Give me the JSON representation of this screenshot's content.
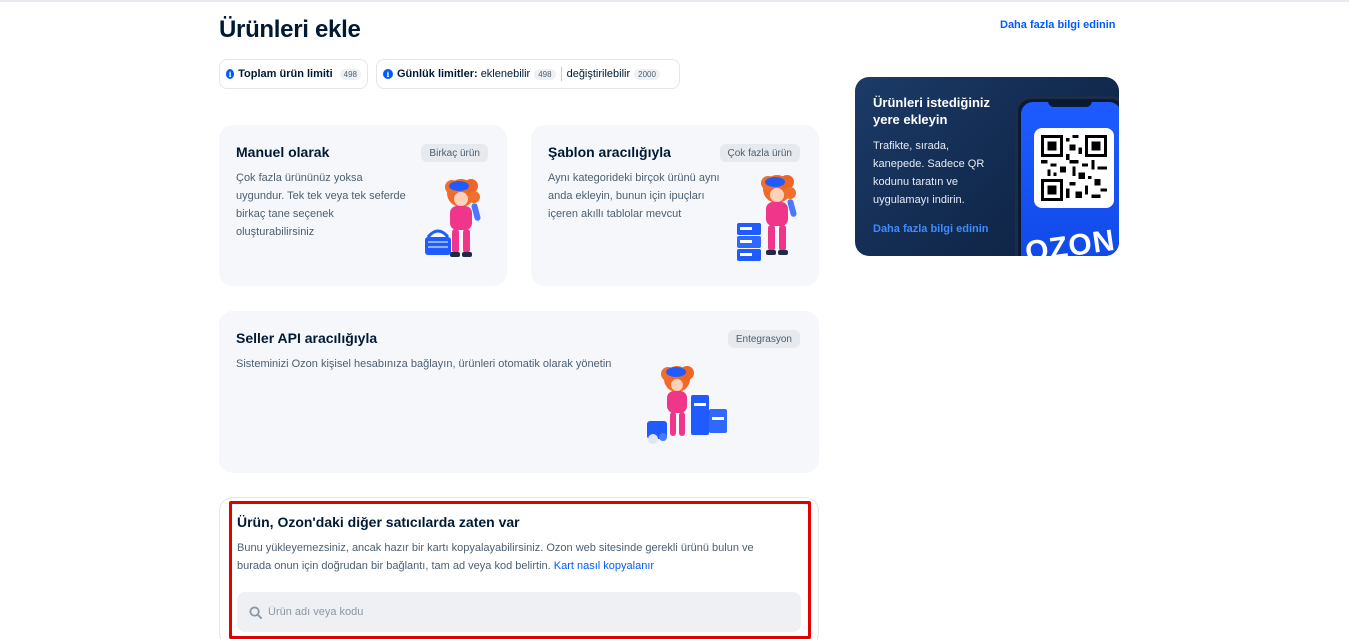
{
  "header": {
    "title": "Ürünleri ekle",
    "more_link": "Daha fazla bilgi edinin"
  },
  "limits": {
    "total_label": "Toplam ürün limiti",
    "total_value": "498",
    "daily_label": "Günlük limitler:",
    "addable_label": "eklenebilir",
    "addable_value": "498",
    "editable_label": "değiştirilebilir",
    "editable_value": "2000"
  },
  "cards": {
    "manual": {
      "title": "Manuel olarak",
      "tag": "Birkaç ürün",
      "desc_lines": [
        "Çok fazla ürününüz yoksa",
        "uygundur. Tek tek veya tek seferde",
        "birkaç tane seçenek",
        "oluşturabilirsiniz"
      ]
    },
    "template": {
      "title": "Şablon aracılığıyla",
      "tag": "Çok fazla ürün",
      "desc_lines": [
        "Aynı kategorideki birçok ürünü aynı",
        "anda ekleyin, bunun için ipuçları",
        "içeren akıllı tablolar mevcut"
      ]
    },
    "api": {
      "title": "Seller API aracılığıyla",
      "tag": "Entegrasyon",
      "desc": "Sisteminizi Ozon kişisel hesabınıza bağlayın, ürünleri otomatik olarak yönetin"
    }
  },
  "promo": {
    "title": "Ürünleri istediğiniz yere ekleyin",
    "desc": "Trafikte, sırada, kanepede. Sadece QR kodunu taratın ve uygulamayı indirin.",
    "link": "Daha fazla bilgi edinin",
    "brand": "OZON"
  },
  "copy_block": {
    "title": "Ürün, Ozon'daki diğer satıcılarda zaten var",
    "desc_line1": "Bunu yükleyemezsiniz, ancak hazır bir kartı kopyalayabilirsiniz. Ozon web sitesinde gerekli ürünü bulun ve",
    "desc_line2": "burada onun için doğrudan bir bağlantı, tam ad veya kod belirtin.",
    "link": "Kart nasıl kopyalanır",
    "search_placeholder": "Ürün adı veya kodu",
    "search_value": ""
  },
  "colors": {
    "accent": "#005bff",
    "highlight_border": "#e00000",
    "mascot_pink": "#f0368a",
    "box_blue": "#1f5bff"
  },
  "icons": [
    "info-icon",
    "search-icon",
    "qr-code-icon"
  ]
}
